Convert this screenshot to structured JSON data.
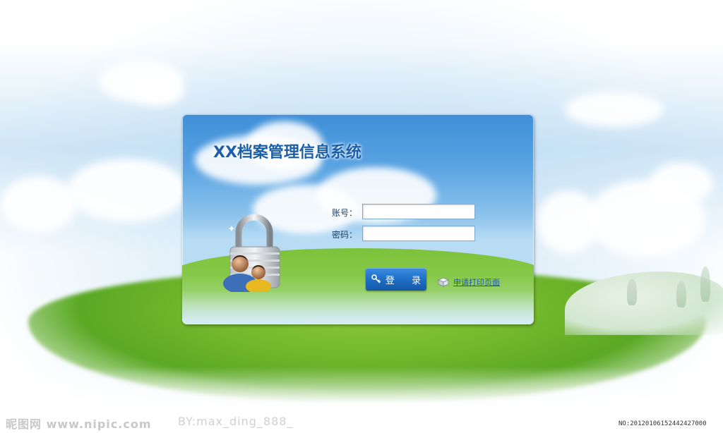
{
  "login": {
    "title": "XX档案管理信息系统",
    "account_label": "账号：",
    "password_label": "密码：",
    "account_value": "",
    "password_value": "",
    "login_button": "登 录",
    "apply_link": "申请打印页面"
  },
  "watermark": {
    "site": "昵图网 www.nipic.com",
    "author": "BY:max_ding_888_",
    "id": "NO:20120106152442427000"
  },
  "colors": {
    "title": "#1a5fa8",
    "button": "#1e6fc6",
    "link": "#1e5aa6"
  },
  "icons": [
    "lock-users-icon",
    "key-icon",
    "package-icon"
  ]
}
